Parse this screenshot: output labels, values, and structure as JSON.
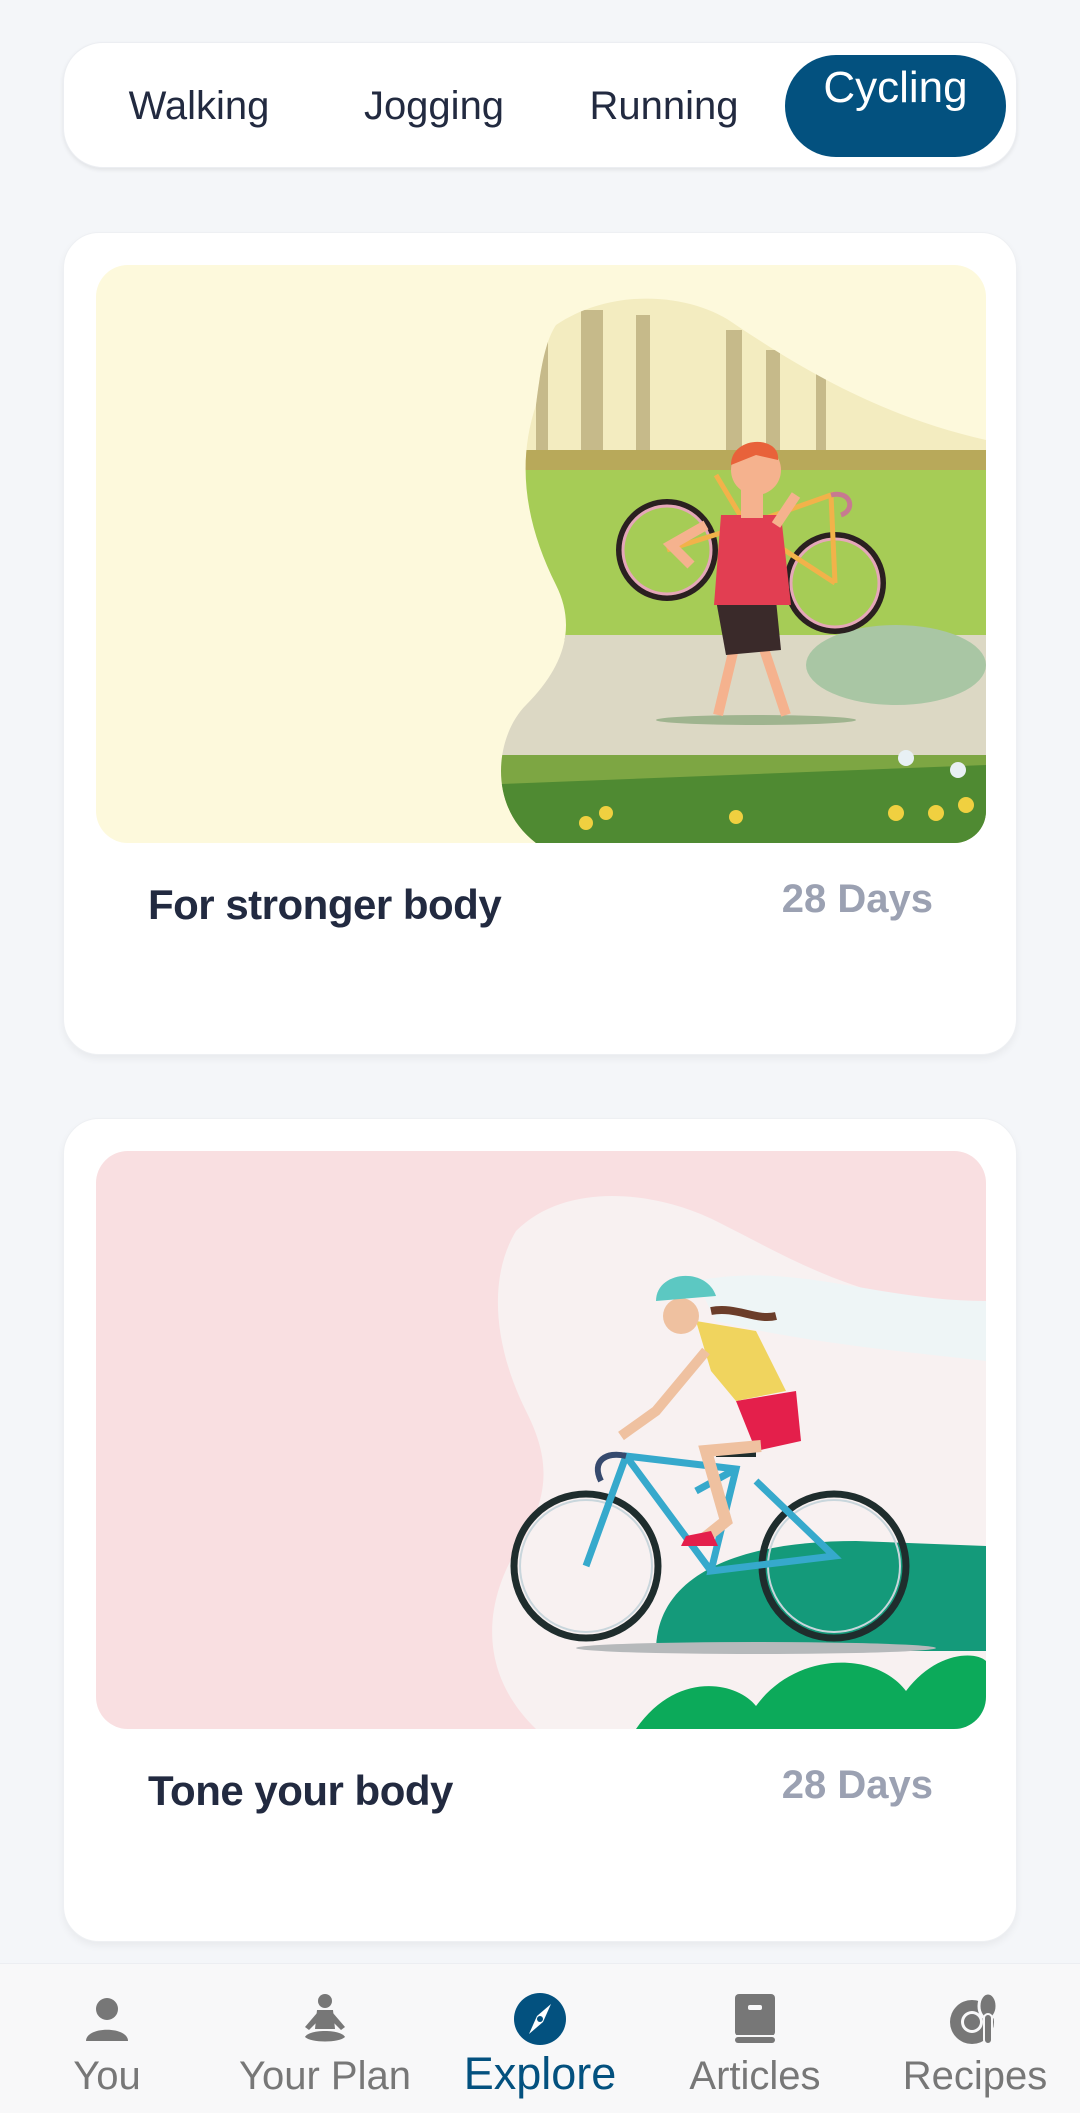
{
  "tabs": [
    {
      "label": "Walking",
      "active": false
    },
    {
      "label": "Jogging",
      "active": false
    },
    {
      "label": "Running",
      "active": false
    },
    {
      "label": "Cycling",
      "active": true
    }
  ],
  "cards": [
    {
      "title": "For stronger body",
      "duration": "28 Days",
      "image": "man-carrying-bicycle-in-park-illustration",
      "bg_color": "#fdf9dc"
    },
    {
      "title": "Tone your body",
      "duration": "28 Days",
      "image": "woman-riding-road-bicycle-illustration",
      "bg_color": "#f9dfe1"
    }
  ],
  "bottom_nav": {
    "items": [
      {
        "label": "You",
        "icon": "person-icon",
        "active": false
      },
      {
        "label": "Your Plan",
        "icon": "meditation-icon",
        "active": false
      },
      {
        "label": "Explore",
        "icon": "compass-icon",
        "active": true
      },
      {
        "label": "Articles",
        "icon": "book-icon",
        "active": false
      },
      {
        "label": "Recipes",
        "icon": "plate-spoon-icon",
        "active": false
      }
    ]
  },
  "colors": {
    "accent": "#03517f",
    "text_primary": "#222a40",
    "text_secondary": "#9ba1b2",
    "nav_inactive": "#777777",
    "background": "#f4f6f9"
  }
}
